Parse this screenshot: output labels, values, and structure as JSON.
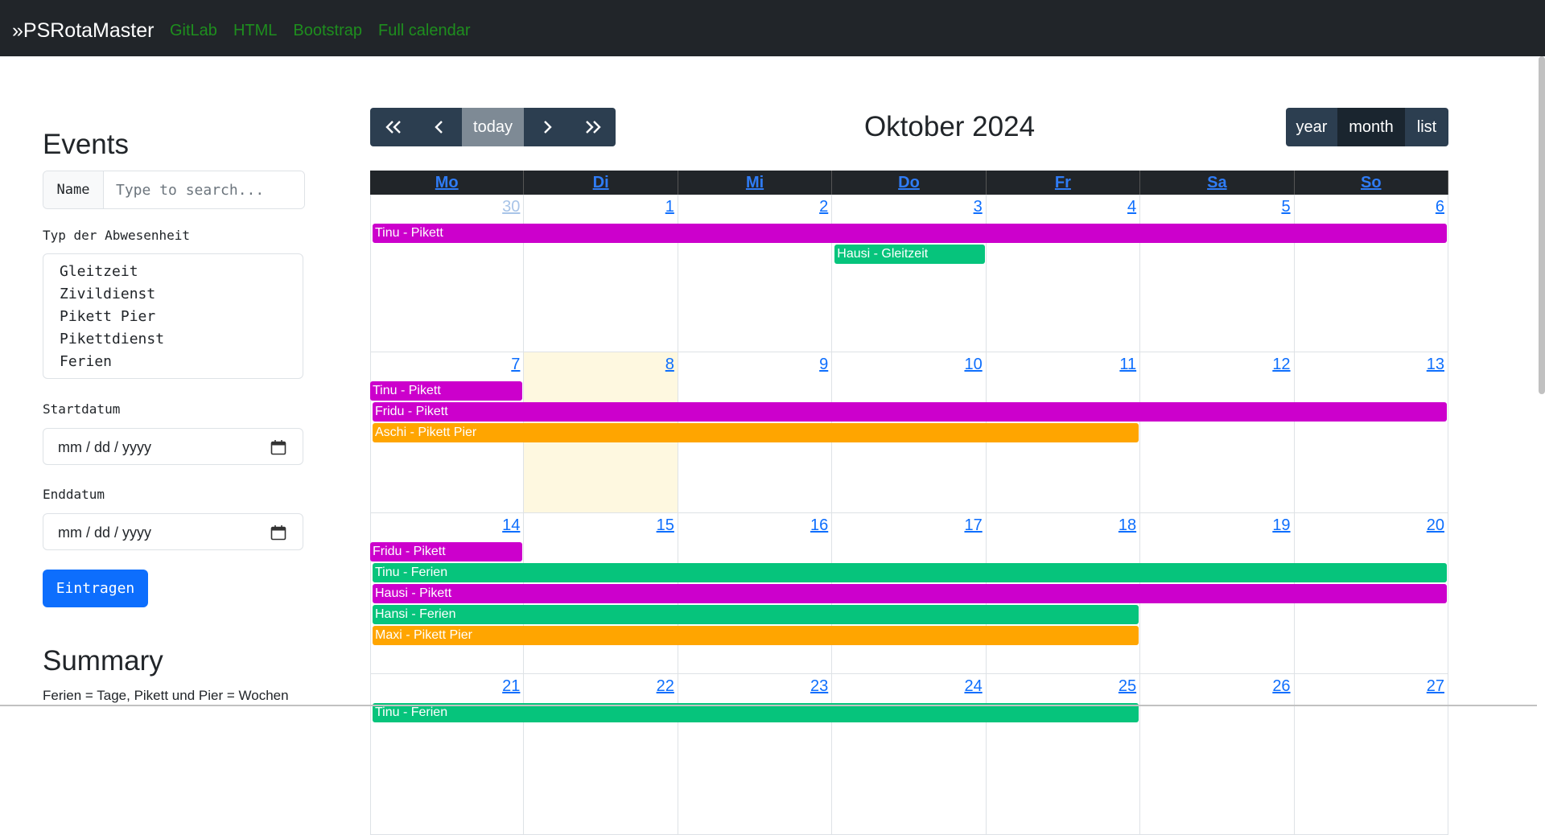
{
  "navbar": {
    "brand": "»PSRotaMaster",
    "links": [
      "GitLab",
      "HTML",
      "Bootstrap",
      "Full calendar"
    ]
  },
  "sidebar": {
    "events_title": "Events",
    "search": {
      "addon": "Name",
      "placeholder": "Type to search..."
    },
    "type_label": "Typ der Abwesenheit",
    "type_options": [
      "Gleitzeit",
      "Zivildienst",
      "Pikett Pier",
      "Pikettdienst",
      "Ferien"
    ],
    "start_label": "Startdatum",
    "end_label": "Enddatum",
    "date_placeholder": "mm / dd / yyyy",
    "submit": "Eintragen",
    "summary_title": "Summary",
    "summary_text": "Ferien = Tage, Pikett und Pier = Wochen"
  },
  "toolbar": {
    "prev_year": "«",
    "prev": "‹",
    "today": "today",
    "next": "›",
    "next_year": "»",
    "title": "Oktober 2024",
    "views": [
      "year",
      "month",
      "list"
    ],
    "active_view": "month"
  },
  "calendar": {
    "weekdays": [
      "Mo",
      "Di",
      "Mi",
      "Do",
      "Fr",
      "Sa",
      "So"
    ],
    "weeks": [
      [
        "30",
        "1",
        "2",
        "3",
        "4",
        "5",
        "6"
      ],
      [
        "7",
        "8",
        "9",
        "10",
        "11",
        "12",
        "13"
      ],
      [
        "14",
        "15",
        "16",
        "17",
        "18",
        "19",
        "20"
      ],
      [
        "21",
        "22",
        "23",
        "24",
        "25",
        "26",
        "27"
      ]
    ],
    "today": "8",
    "colors": {
      "pikett": "#cc00cc",
      "ferien": "#06c47c",
      "gleitzeit": "#06c47c",
      "pier": "#ffa500"
    },
    "events": [
      {
        "title": "Tinu - Pikett",
        "color": "#cc00cc",
        "week": 0,
        "start": 0,
        "end": 6,
        "lane": 0
      },
      {
        "title": "Hausi - Gleitzeit",
        "color": "#06c47c",
        "week": 0,
        "start": 3,
        "end": 3,
        "lane": 1
      },
      {
        "title": "Tinu - Pikett",
        "color": "#cc00cc",
        "week": 1,
        "start": 0,
        "end": 0,
        "lane": 0
      },
      {
        "title": "Fridu - Pikett",
        "color": "#cc00cc",
        "week": 1,
        "start": 0,
        "end": 6,
        "lane": 1
      },
      {
        "title": "Aschi - Pikett Pier",
        "color": "#ffa500",
        "week": 1,
        "start": 0,
        "end": 4,
        "lane": 2
      },
      {
        "title": "Fridu - Pikett",
        "color": "#cc00cc",
        "week": 2,
        "start": 0,
        "end": 0,
        "lane": 0
      },
      {
        "title": "Tinu - Ferien",
        "color": "#06c47c",
        "week": 2,
        "start": 0,
        "end": 6,
        "lane": 1
      },
      {
        "title": "Hausi - Pikett",
        "color": "#cc00cc",
        "week": 2,
        "start": 0,
        "end": 6,
        "lane": 2
      },
      {
        "title": "Hansi - Ferien",
        "color": "#06c47c",
        "week": 2,
        "start": 0,
        "end": 4,
        "lane": 3
      },
      {
        "title": "Maxi - Pikett Pier",
        "color": "#ffa500",
        "week": 2,
        "start": 0,
        "end": 4,
        "lane": 4
      },
      {
        "title": "Tinu - Ferien",
        "color": "#06c47c",
        "week": 3,
        "start": 0,
        "end": 4,
        "lane": 0
      }
    ]
  }
}
